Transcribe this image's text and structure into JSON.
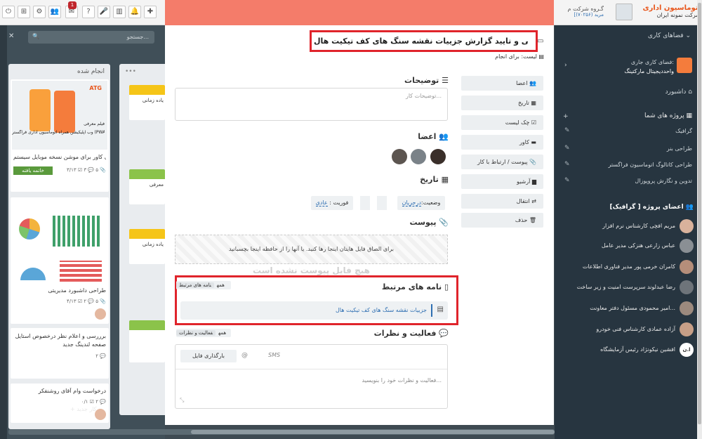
{
  "topbar": {
    "notif_count": "1",
    "brand_title": "اتوماسیون اداری",
    "brand_subtitle": "شرکت نمونه ایران",
    "group_text": "گـروه شرکت م",
    "group_code": "(۷۰۲۵۶)",
    "group_user": "[مرید"
  },
  "left": {
    "search_placeholder": "جستجو...",
    "col_done": "انجام شده",
    "col_dots": "•••",
    "card1_brand": "ATG",
    "card1_promo_a": "فیلم معرفی",
    "card1_promo_b": "وب اپلیکیشن همراه اتوماسیون اداری فراگستر (PWA)",
    "card1_title": "طراحی کاور برای موشن نسخه موبایل سیستم",
    "card1_badge": "خاتمه یافته",
    "card1_meta": "۳/۱۳ ☑  ۳ 💬  ۵ 📎",
    "card2_title": "طراحی داشبورد مدیریتی",
    "card2_meta": "۴/۱۳ ☑  ۲ 💬  ۵ 📎",
    "card3_title": "برررسی و اعلام نظر درخصوص استایل صفحه لندینگ جدید",
    "card3_meta": "۲ 💬",
    "card4_title": "درخواست وام آقای روشنفکر",
    "card4_meta": "۰/۱ ☑  ۲ 💬",
    "col2_c1": "یاده زمانی",
    "col2_c2": "معرفی",
    "col2_c3": "یاده زمانی",
    "add_card": "+ کار جدید"
  },
  "modal": {
    "title": "بررسی و تایید گزارش جزییات نقشه سنگ های کف تیکیت هال",
    "list_label": "لیست: برای انجام",
    "desc_label": "توضیحات",
    "desc_placeholder": "توضیحات کار...",
    "members_label": "اعضا",
    "date_label": "تاریخ",
    "status_key": "وضعیت:",
    "status_value": "درجریان",
    "priority_key": "فوریت :",
    "priority_value": "عادی",
    "attach_label": "پیوست",
    "attach_drop": "برای الصاق فایل هایتان اینجا رها کنید. یا آنها را از حافظه اینجا بچسبانید",
    "attach_empty": "هیچ فایل پیوست نشده است",
    "related_label": "نامه های مرتبط",
    "related_all": "همه",
    "related_tag": "نامه های مرتبط",
    "related_item": "جزییات نقشه سنگ های کف تیکیت هال",
    "activity_label": "فعالیت و نظرات",
    "activity_all": "همه",
    "activity_tag": "فعالیت و نظرات",
    "tab_sms": "SMS",
    "tab_at": "@",
    "tab_upload": "بارگذاری فایل",
    "comment_placeholder": "فعالیت و نظرات خود را بنویسید..."
  },
  "sidebar_buttons": [
    "اعضا",
    "تاریخ",
    "چک لیست",
    "کاور",
    "پیوست / ارتباط با کار",
    "آرشیو",
    "انتقال",
    "حذف"
  ],
  "right": {
    "workspaces": "فضاهای کاری",
    "current_ws": "فضای کاری جاری:",
    "ws_name": "واحددیجیتال مارکتینگ",
    "dashboard": "داشبورد",
    "projects": "پروژه های شما",
    "project_items": [
      "گرافیک",
      "طراحی بنر",
      "طراحی کاتالوگ اتوماسیون فراگستر",
      "تدوین و نگارش پروپوزال"
    ],
    "members_title": "اعضای پروژه [ گرافیک]",
    "members": [
      "مریم افچی کارشناس نرم افزار",
      "عباس زارعی هنزکی مدیر عامل",
      "کامران خرمی پور مدیر فناوری اطلاعات",
      "رضا عبدلوند سرپرست امنیت و زیر ساخت",
      "امیر محمودی مسئول دفتر معاونت...",
      "آزاده عمادی کارشناس فنی خودرو",
      "افشین نیکونژاد رئیس آزمایشگاه"
    ],
    "last_initials": "ا.ن"
  },
  "colors": {
    "modal_header": "#f47c6a",
    "highlight": "#e0242b",
    "done_badge": "#5a9a3c",
    "link": "#2f6fb2"
  }
}
